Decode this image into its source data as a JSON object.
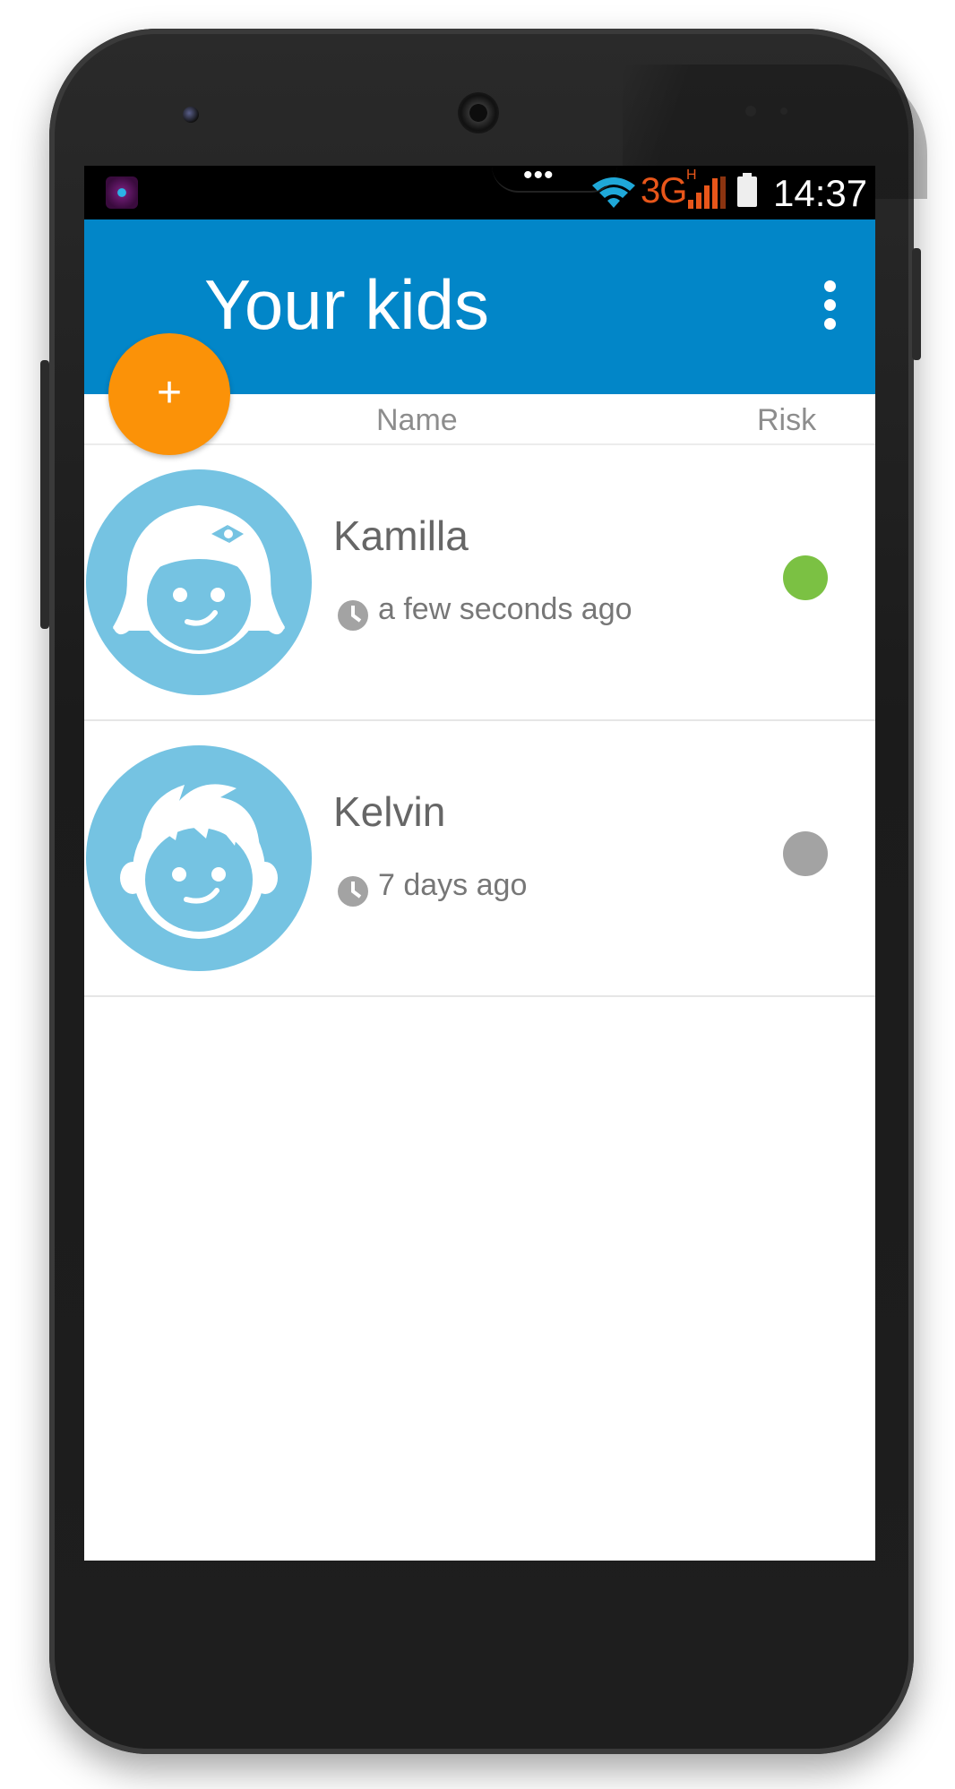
{
  "status_bar": {
    "network": "3G",
    "network_sub": "H",
    "time": "14:37",
    "icons": [
      "app-notification-icon",
      "more-notifications-icon",
      "wifi-icon",
      "signal-icon",
      "battery-icon"
    ]
  },
  "appbar": {
    "title": "Your kids",
    "overflow_icon": "more-vert-icon"
  },
  "fab": {
    "label": "+",
    "icon": "add-icon",
    "color": "#fb9208"
  },
  "list_header": {
    "name": "Name",
    "risk": "Risk"
  },
  "kids": [
    {
      "name": "Kamilla",
      "last_seen": "a few seconds ago",
      "avatar": "girl-avatar-icon",
      "risk_color": "#7bc143"
    },
    {
      "name": "Kelvin",
      "last_seen": "7 days ago",
      "avatar": "boy-avatar-icon",
      "risk_color": "#a3a3a3"
    }
  ],
  "colors": {
    "primary": "#0286c8",
    "accent": "#fb9208",
    "avatar_bg": "#75c3e2"
  }
}
